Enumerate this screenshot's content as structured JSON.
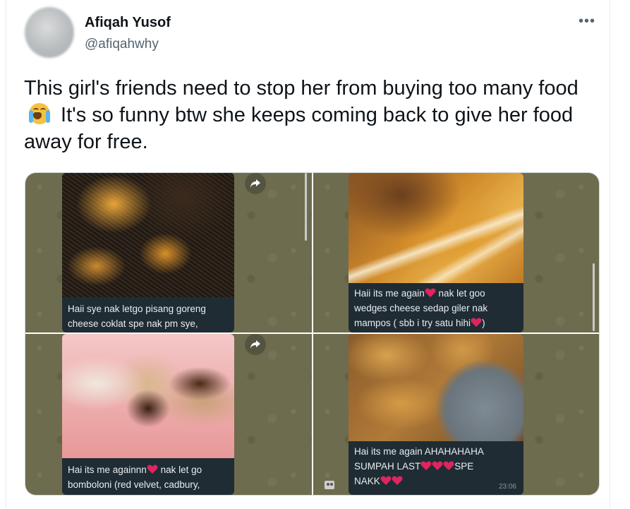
{
  "author": {
    "name": "Afiqah Yusof",
    "handle": "@afiqahwhy"
  },
  "more_icon": "more-horizontal-icon",
  "tweet": {
    "text_before_emoji": "This girl's friends need to stop her from buying too many food",
    "emoji": "loudly-crying-face",
    "text_after_emoji": " It's so funny btw she keeps coming back to give her food away for free."
  },
  "media": [
    {
      "caption_line1": "Haii sye nak letgo pisang goreng",
      "caption_line2": "cheese coklat spe nak pm sye,"
    },
    {
      "caption_line1": "Haii its me again",
      "caption_line1_after": " nak let goo",
      "caption_line2": "wedges cheese sedap giler nak",
      "caption_line3": "mampos ( sbb i try satu hihi",
      "caption_line3_after": ")"
    },
    {
      "caption_line1": "Hai its me againnn",
      "caption_line1_after": " nak let go",
      "caption_line2": "bomboloni (red velvet, cadbury,"
    },
    {
      "caption_line1": "Hai its me again AHAHAHAHA",
      "caption_line2": "SUMPAH LAST",
      "caption_line2_after": "SPE",
      "caption_line3": "NAKK",
      "time": "23:06"
    }
  ],
  "colors": {
    "wallpaper": "#6e6c4e",
    "bubble": "#1f2c34",
    "heart": "#e0245e"
  }
}
